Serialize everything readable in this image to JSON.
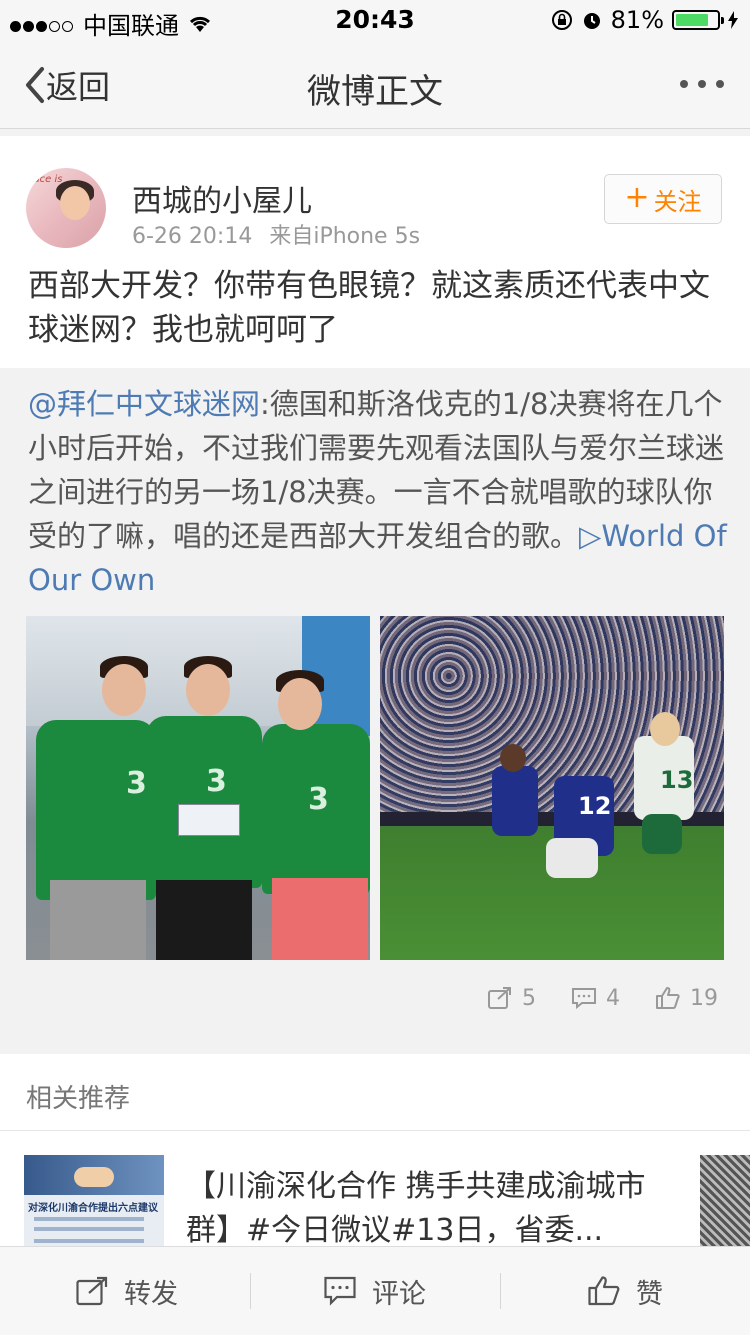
{
  "status_bar": {
    "carrier": "中国联通",
    "time": "20:43",
    "battery": "81%",
    "battery_level": 0.81,
    "signal_bars": 3
  },
  "nav": {
    "back_label": "返回",
    "title": "微博正文"
  },
  "post": {
    "username": "西城的小屋儿",
    "time": "6-26 20:14",
    "source": "来自iPhone 5s",
    "follow_label": "关注",
    "text": "西部大开发？你带有色眼镜？就这素质还代表中文球迷网？我也就呵呵了"
  },
  "repost": {
    "mention": "@拜仁中文球迷网",
    "text": ":德国和斯洛伐克的1/8决赛将在几个小时后开始，不过我们需要先观看法国队与爱尔兰球迷之间进行的另一场1/8决赛。一言不合就唱歌的球队你受的了嘛，唱的还是西部大开发组合的歌。",
    "link_icon": "▷",
    "link_text": "World Of Our Own",
    "stats": {
      "reposts": "5",
      "comments": "4",
      "likes": "19"
    }
  },
  "related": {
    "header": "相关推荐",
    "item_title": "【川渝深化合作 携手共建成渝城市群】#今日微议#13日，省委...",
    "thumb_caption": "对深化川渝合作提出六点建议"
  },
  "toolbar": {
    "repost_label": "转发",
    "comment_label": "评论",
    "like_label": "赞"
  },
  "colors": {
    "accent_orange": "#ff8200",
    "link_blue": "#4e7bb3",
    "battery_green": "#4cd964"
  }
}
